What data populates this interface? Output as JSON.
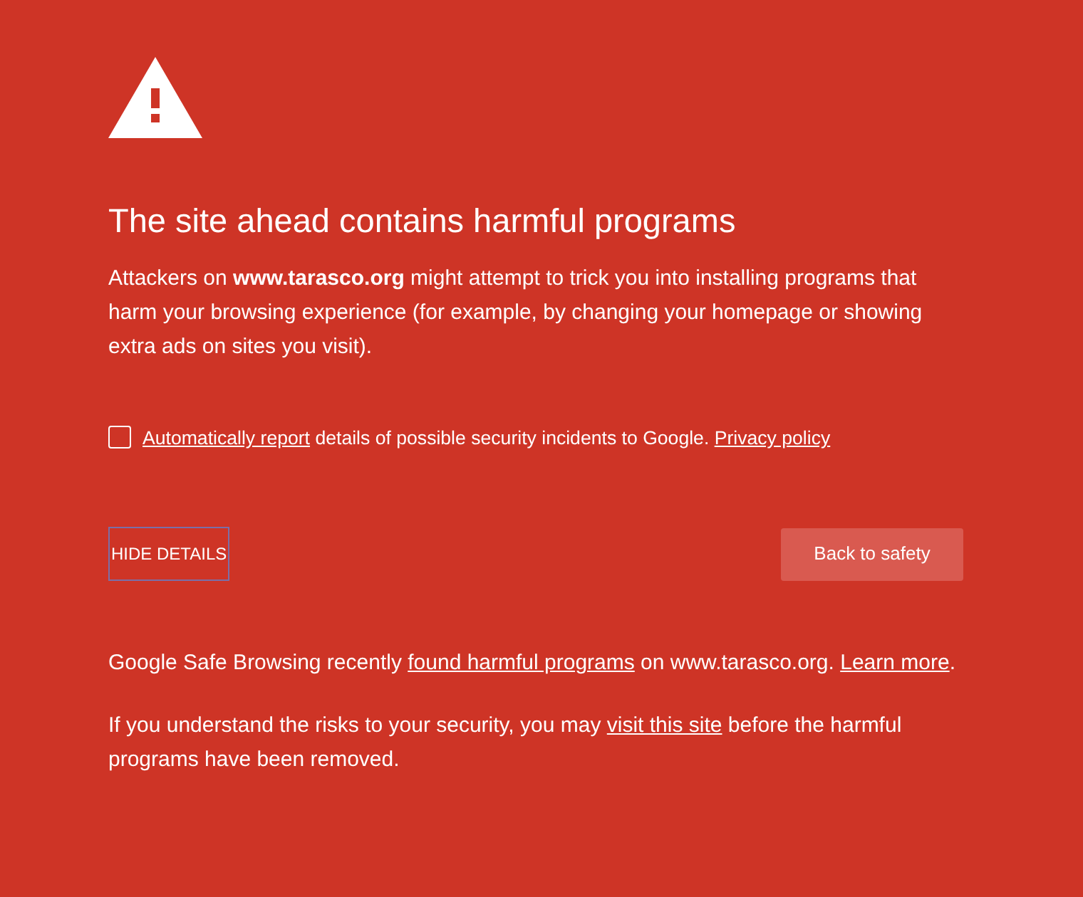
{
  "heading": "The site ahead contains harmful programs",
  "intro": "Attackers on **www.tarasco.org** might attempt to trick you into installing programs that harm your browsing experience (for example, by changing your homepage or showing extra ads on sites you visit).",
  "report": {
    "checked": false,
    "segments": [
      {
        "text": "Automatically report",
        "link": true
      },
      {
        "text": " details of possible security incidents to Google. ",
        "link": false
      },
      {
        "text": "Privacy policy",
        "link": true
      }
    ]
  },
  "buttons": {
    "details": "HIDE DETAILS",
    "primary": "Back to safety"
  },
  "details": [
    {
      "segments": [
        {
          "text": "Google Safe Browsing recently ",
          "link": false
        },
        {
          "text": "found harmful programs",
          "link": true
        },
        {
          "text": " on www.tarasco.org. ",
          "link": false
        },
        {
          "text": "Learn more",
          "link": true
        },
        {
          "text": ".",
          "link": false
        }
      ]
    },
    {
      "segments": [
        {
          "text": "If you understand the risks to your security, you may ",
          "link": false
        },
        {
          "text": "visit this site",
          "link": true
        },
        {
          "text": " before the harmful programs have been removed.",
          "link": false
        }
      ]
    }
  ]
}
